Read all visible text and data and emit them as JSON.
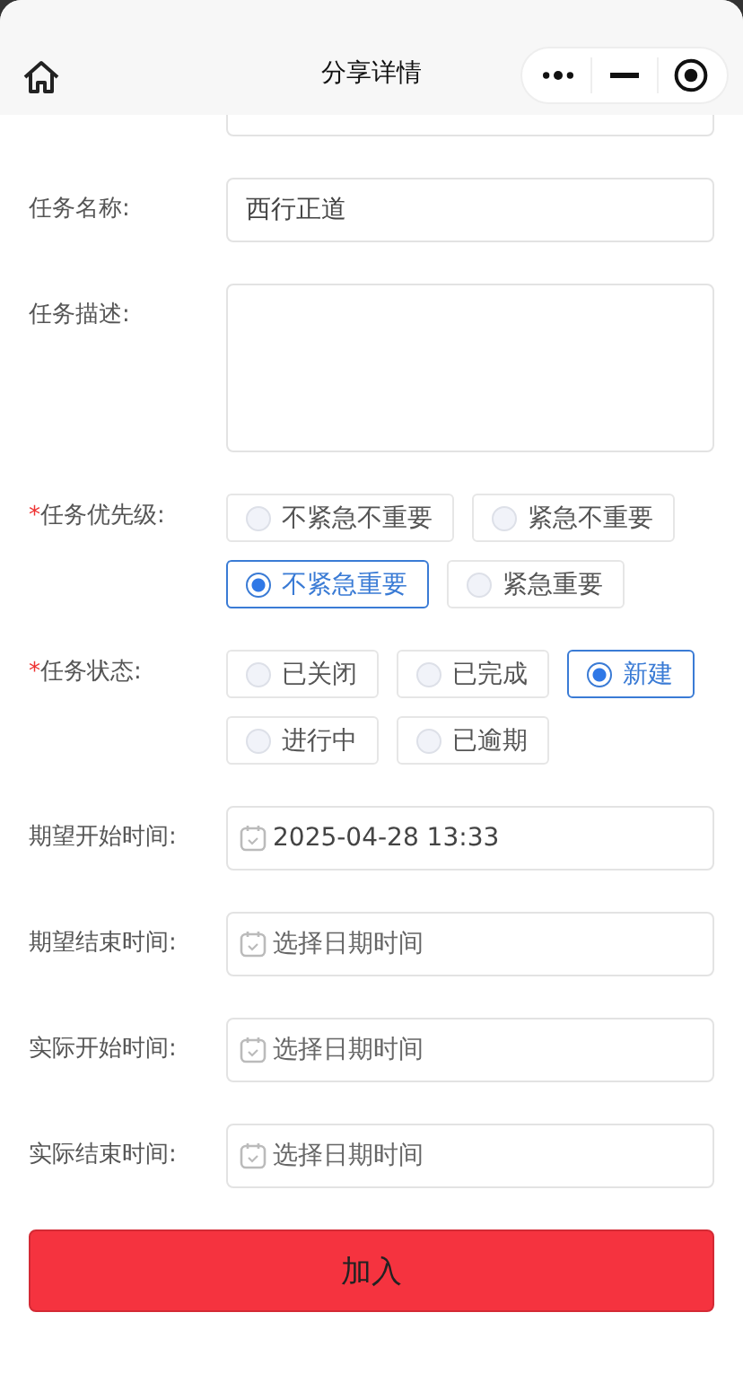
{
  "header": {
    "title": "分享详情"
  },
  "fields": [
    {
      "kind": "covered"
    },
    {
      "kind": "input",
      "label": "任务名称:",
      "value": "西行正道"
    },
    {
      "kind": "textarea",
      "label": "任务描述:"
    },
    {
      "kind": "radio",
      "required_mark": "*",
      "label": "任务优先级:",
      "options": [
        {
          "label": "不紧急不重要",
          "selected": false
        },
        {
          "label": "紧急不重要",
          "selected": false
        },
        {
          "label": "不紧急重要",
          "selected": true
        },
        {
          "label": "紧急重要",
          "selected": false
        }
      ]
    },
    {
      "kind": "radio",
      "required_mark": "*",
      "label": "任务状态:",
      "options": [
        {
          "label": "已关闭",
          "selected": false
        },
        {
          "label": "已完成",
          "selected": false
        },
        {
          "label": "新建",
          "selected": true
        },
        {
          "label": "进行中",
          "selected": false
        },
        {
          "label": "已逾期",
          "selected": false
        }
      ]
    },
    {
      "kind": "date",
      "label": "期望开始时间:",
      "value": "2025-04-28 13:33"
    },
    {
      "kind": "date",
      "label": "期望结束时间:",
      "placeholder": "选择日期时间"
    },
    {
      "kind": "date",
      "label": "实际开始时间:",
      "placeholder": "选择日期时间"
    },
    {
      "kind": "date",
      "label": "实际结束时间:",
      "placeholder": "选择日期时间"
    }
  ],
  "submit_button": "加入"
}
